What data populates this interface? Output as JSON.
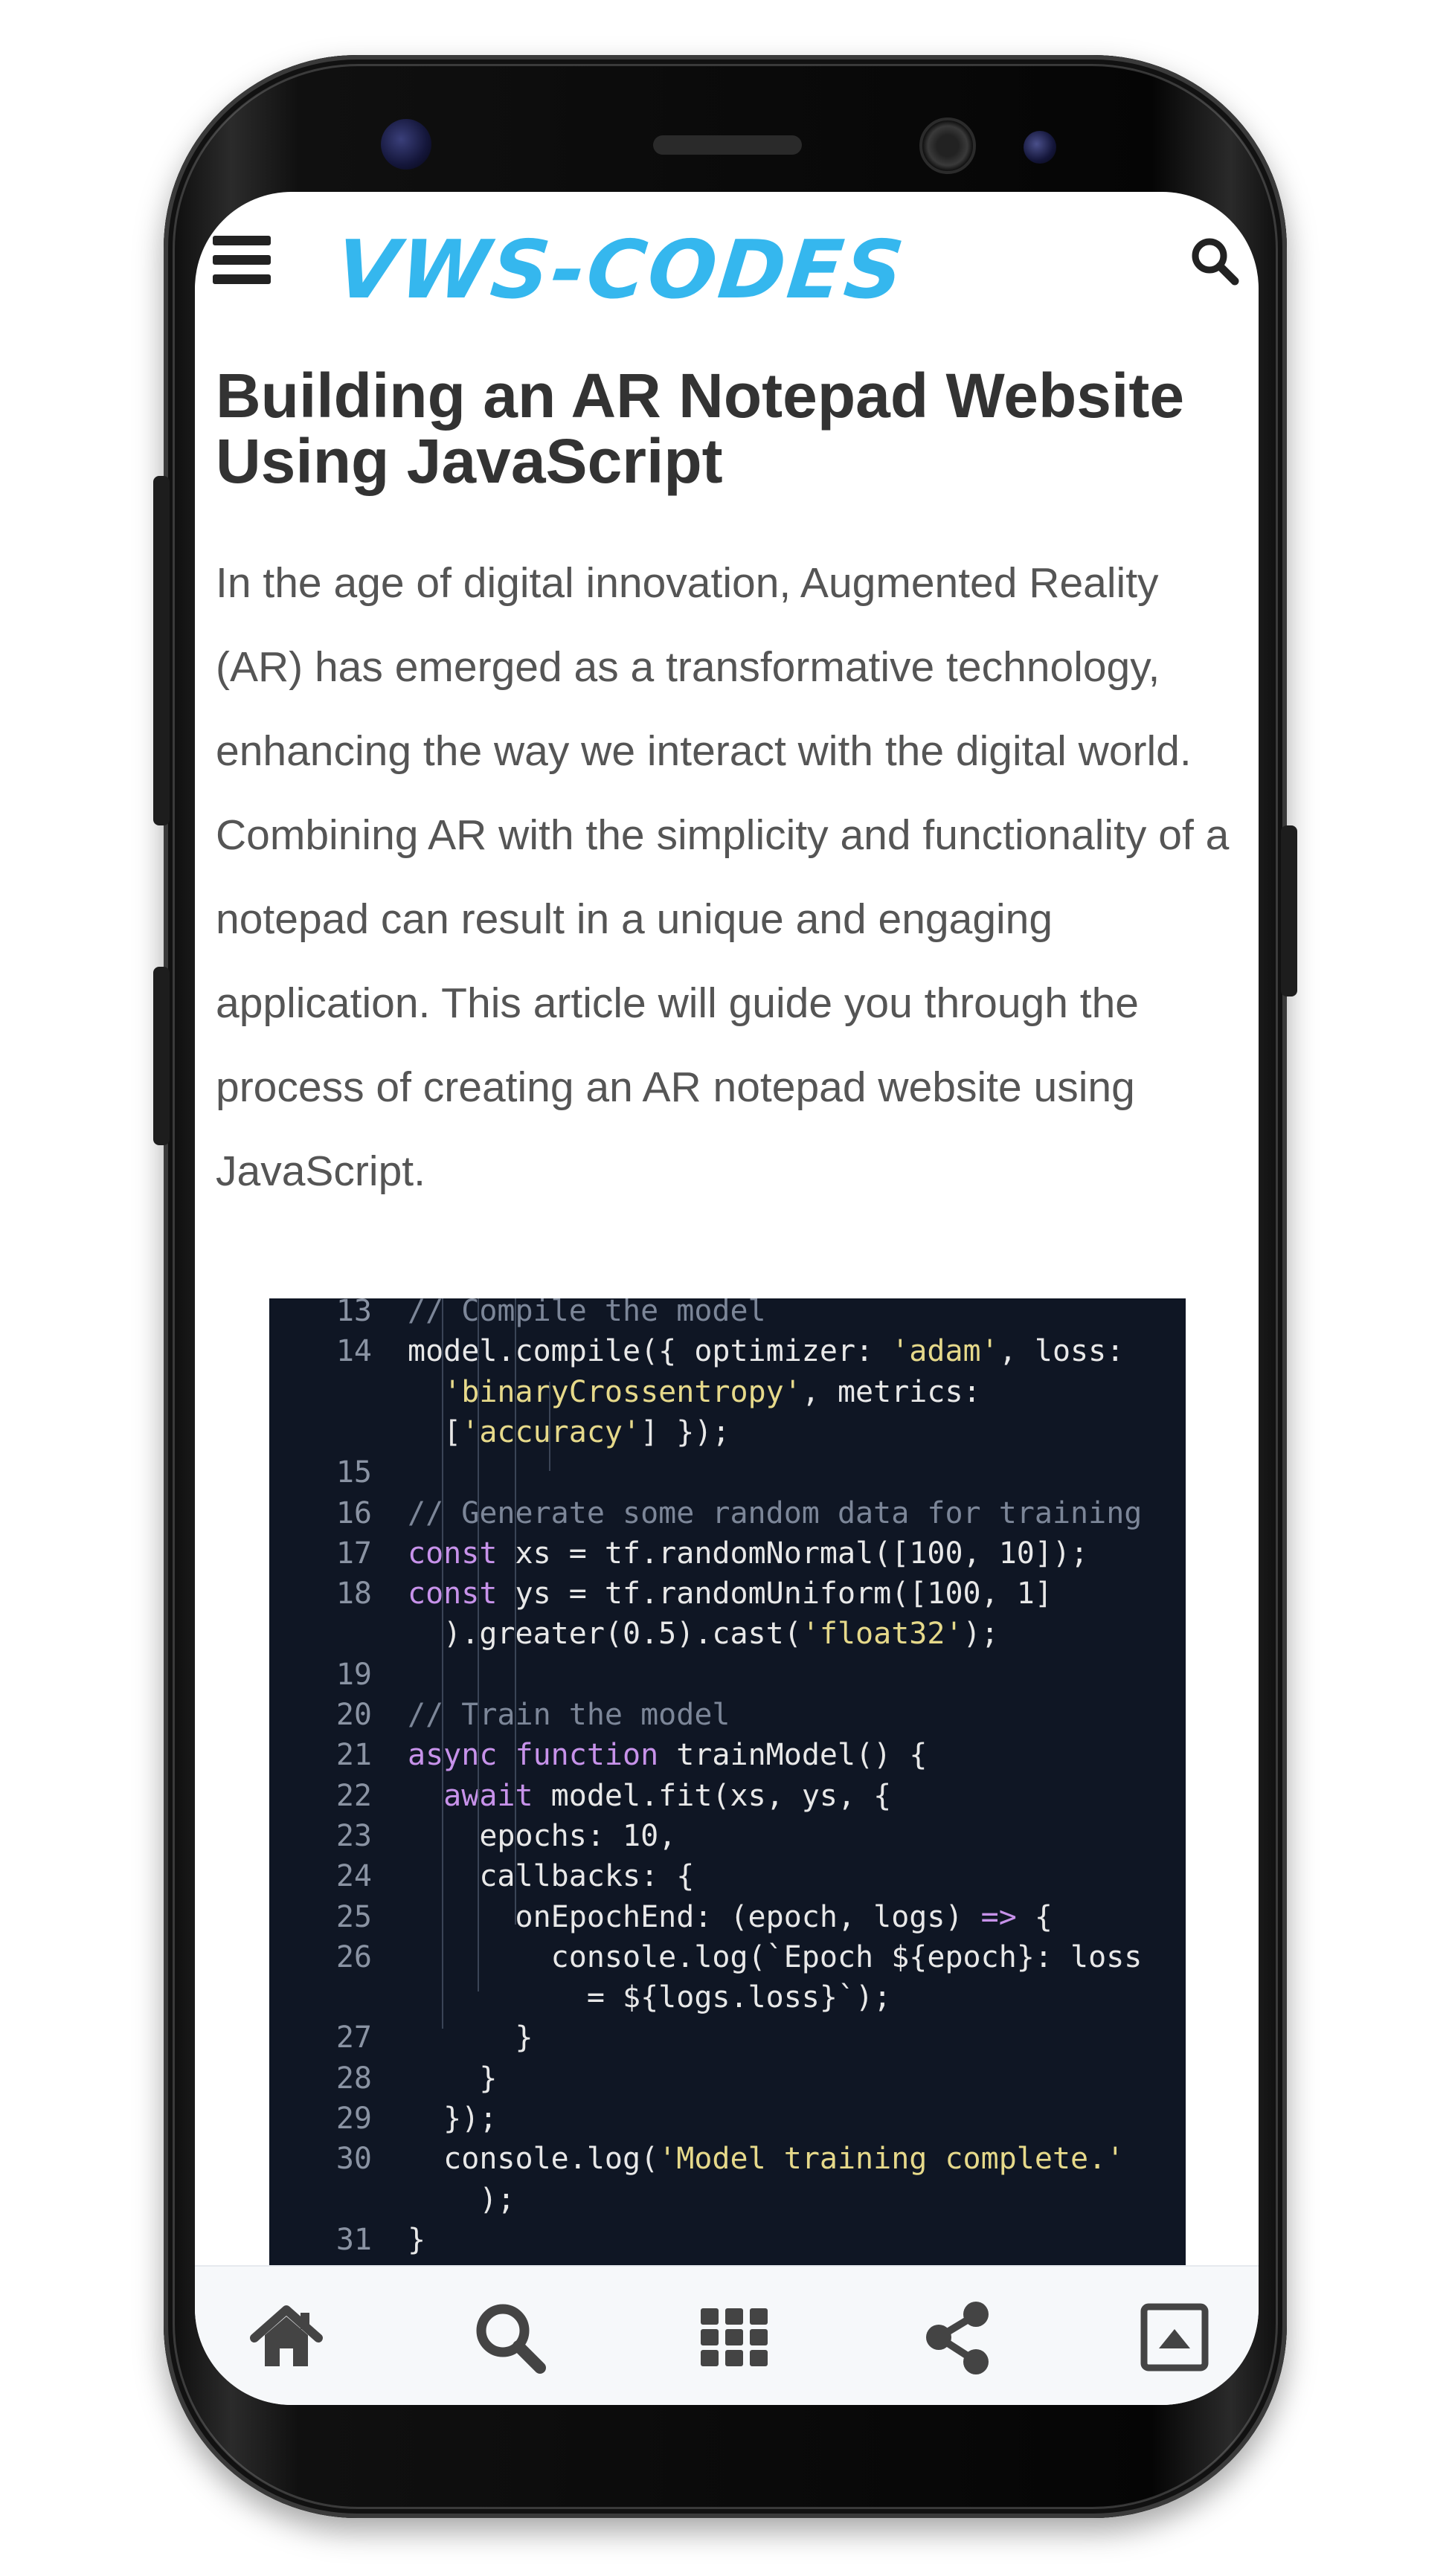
{
  "header": {
    "logo_text": "VWS-CODES",
    "menu_icon": "hamburger-menu-icon",
    "search_icon": "search-icon"
  },
  "article": {
    "title_line1": "Building an AR Notepad Website",
    "title_line2": "Using JavaScript",
    "intro": "In the age of digital innovation, Augmented Reality (AR) has emerged as a transformative technology, enhancing the way we interact with the digital world. Combining AR with the simplicity and functionality of a notepad can result in a unique and engaging application. This article will guide you through the process of creating an AR notepad website using JavaScript."
  },
  "code": {
    "lines": [
      {
        "n": "13",
        "t": "// Compile the model"
      },
      {
        "n": "14",
        "t": "model.compile({ optimizer: 'adam', loss:"
      },
      {
        "n": "",
        "t": "  'binaryCrossentropy', metrics:"
      },
      {
        "n": "",
        "t": "  ['accuracy'] });"
      },
      {
        "n": "15",
        "t": ""
      },
      {
        "n": "16",
        "t": "// Generate some random data for training"
      },
      {
        "n": "17",
        "t": "const xs = tf.randomNormal([100, 10]);"
      },
      {
        "n": "18",
        "t": "const ys = tf.randomUniform([100, 1]"
      },
      {
        "n": "",
        "t": "  ).greater(0.5).cast('float32');"
      },
      {
        "n": "19",
        "t": ""
      },
      {
        "n": "20",
        "t": "// Train the model"
      },
      {
        "n": "21",
        "t": "async function trainModel() {"
      },
      {
        "n": "22",
        "t": "  await model.fit(xs, ys, {"
      },
      {
        "n": "23",
        "t": "    epochs: 10,"
      },
      {
        "n": "24",
        "t": "    callbacks: {"
      },
      {
        "n": "25",
        "t": "      onEpochEnd: (epoch, logs) => {"
      },
      {
        "n": "26",
        "t": "        console.log(`Epoch ${epoch}: loss"
      },
      {
        "n": "",
        "t": "          = ${logs.loss}`);"
      },
      {
        "n": "27",
        "t": "      }"
      },
      {
        "n": "28",
        "t": "    }"
      },
      {
        "n": "29",
        "t": "  });"
      },
      {
        "n": "30",
        "t": "  console.log('Model training complete.'"
      },
      {
        "n": "",
        "t": "    );"
      },
      {
        "n": "31",
        "t": "}"
      }
    ]
  },
  "bottom_nav": {
    "items": [
      {
        "icon": "home-icon"
      },
      {
        "icon": "search-icon"
      },
      {
        "icon": "grid-icon"
      },
      {
        "icon": "share-icon"
      },
      {
        "icon": "scroll-to-top-icon"
      }
    ]
  },
  "colors": {
    "logo": "#35b7ee",
    "code_bg": "#0f1624",
    "nav_bg": "#f6f8fa",
    "icon": "#444444"
  }
}
